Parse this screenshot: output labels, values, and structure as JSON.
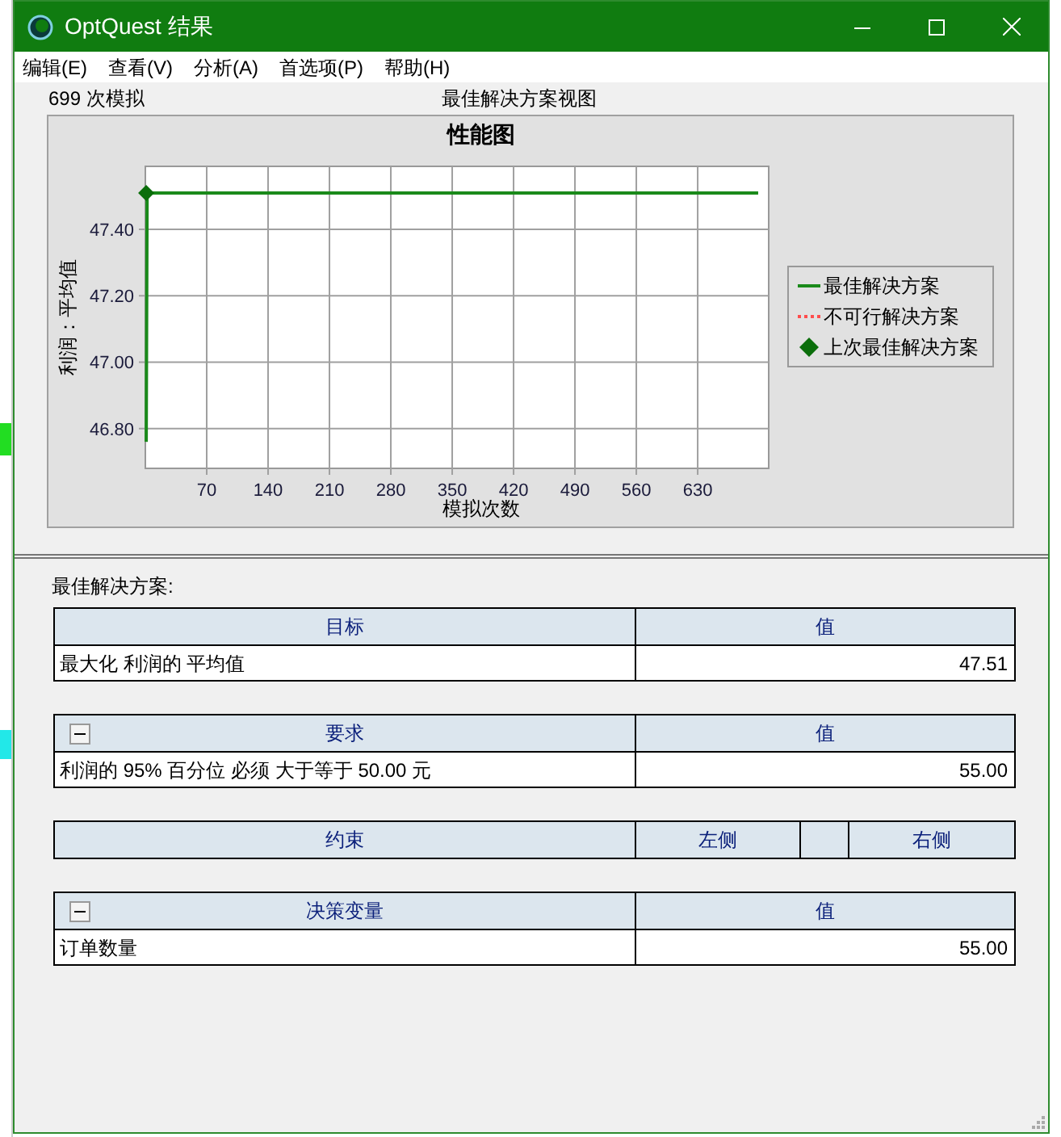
{
  "window": {
    "title": "OptQuest 结果"
  },
  "menu": [
    "编辑(E)",
    "查看(V)",
    "分析(A)",
    "首选项(P)",
    "帮助(H)"
  ],
  "simulations": "699 次模拟",
  "view_title": "最佳解决方案视图",
  "chart": {
    "chart_data": {
      "type": "line",
      "title": "性能图",
      "xlabel": "模拟次数",
      "ylabel": "利润：平均值",
      "xlim": [
        0,
        711
      ],
      "ylim": [
        46.68,
        47.59
      ],
      "xticks": [
        70,
        140,
        210,
        280,
        350,
        420,
        490,
        560,
        630
      ],
      "yticks": [
        {
          "value": 46.8,
          "label": "46.80"
        },
        {
          "value": 47.0,
          "label": "47.00"
        },
        {
          "value": 47.2,
          "label": "47.20"
        },
        {
          "value": 47.4,
          "label": "47.40"
        }
      ],
      "grid": true,
      "legend": true,
      "x": [
        1,
        2,
        699
      ],
      "series": [
        {
          "name": "最佳解决方案",
          "color": "#1a8a1a",
          "values": [
            46.76,
            47.51,
            47.51
          ]
        },
        {
          "name": "不可行解决方案",
          "color": "#ff4d4d",
          "values": [
            null,
            null,
            null
          ]
        },
        {
          "name": "上次最佳解决方案",
          "color": "#0b6e0b",
          "marker": "diamond",
          "values": [
            47.51,
            null,
            null
          ]
        }
      ]
    }
  },
  "best_label": "最佳解决方案:",
  "tables": [
    {
      "kind": "objective",
      "columns": [
        "目标",
        "值"
      ],
      "rows": [
        [
          "最大化 利润的 平均值",
          "47.51"
        ]
      ]
    },
    {
      "kind": "collapsible",
      "expanded": true,
      "columns": [
        "要求",
        "值"
      ],
      "rows": [
        [
          "利润的 95% 百分位 必须 大于等于 50.00 元",
          "55.00"
        ]
      ]
    },
    {
      "kind": "constraints",
      "columns": [
        "约束",
        "左侧",
        "右侧"
      ]
    },
    {
      "kind": "collapsible",
      "expanded": true,
      "columns": [
        "决策变量",
        "值"
      ],
      "rows": [
        [
          "订单数量",
          "55.00"
        ]
      ]
    }
  ]
}
